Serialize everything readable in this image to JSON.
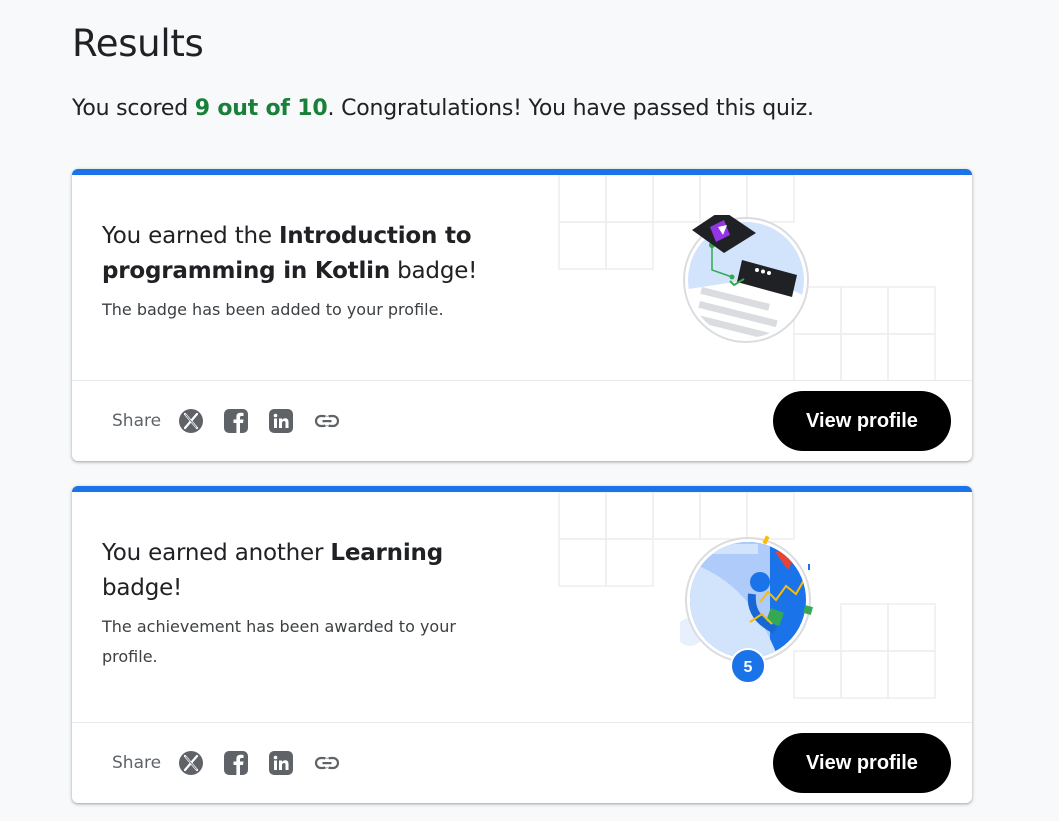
{
  "page": {
    "title": "Results",
    "score_prefix": "You scored ",
    "score_value": "9 out of 10",
    "score_suffix": ". Congratulations! You have passed this quiz."
  },
  "colors": {
    "accent": "#1a73e8",
    "score": "#188038",
    "button": "#000000"
  },
  "cards": [
    {
      "headline_prefix": "You earned the ",
      "headline_bold": "Introduction to programming in Kotlin",
      "headline_suffix": " badge!",
      "description": "The badge has been added to your profile.",
      "share_label": "Share",
      "share_icons": [
        "x-icon",
        "facebook-icon",
        "linkedin-icon",
        "link-icon"
      ],
      "button_label": "View profile"
    },
    {
      "headline_prefix": "You earned another ",
      "headline_bold": "Learning",
      "headline_suffix": " badge!",
      "description": "The achievement has been awarded to your profile.",
      "badge_count": "5",
      "share_label": "Share",
      "share_icons": [
        "x-icon",
        "facebook-icon",
        "linkedin-icon",
        "link-icon"
      ],
      "button_label": "View profile"
    }
  ]
}
